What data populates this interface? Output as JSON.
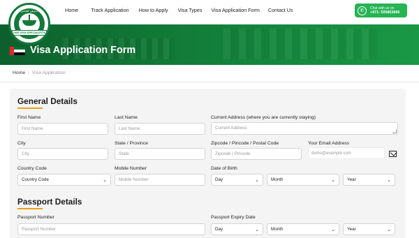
{
  "logo": {
    "top_text": "مكتب الدوبلي للتاشيرات",
    "ribbon": "UAE VISA SPECIALISTS"
  },
  "nav": [
    "Home",
    "Track Application",
    "How to Apply",
    "Visa Types",
    "Visa Application Form",
    "Contact Us"
  ],
  "whatsapp": {
    "line1": "Chat with us on",
    "line2": "+971- 505863666"
  },
  "banner": {
    "title": "Visa Application Form"
  },
  "colors": {
    "flag_red": "#e0262d",
    "flag_green": "#00732f",
    "flag_white": "#ffffff",
    "flag_black": "#000000"
  },
  "breadcrumb": {
    "home": "Home",
    "current": "Visa Application"
  },
  "general": {
    "title": "General Details",
    "first_name": {
      "label": "First Name",
      "placeholder": "First Name"
    },
    "last_name": {
      "label": "Last Name",
      "placeholder": "Last Name"
    },
    "address": {
      "label": "Current Address (where you are currently staying)",
      "placeholder": "Current Address"
    },
    "city": {
      "label": "City",
      "placeholder": "City"
    },
    "state": {
      "label": "State / Province",
      "placeholder": "State"
    },
    "zip": {
      "label": "Zipcode / Pincode / Postal Code",
      "placeholder": "Zipcode / Pincode"
    },
    "email": {
      "label": "Your Email Address",
      "placeholder": "demo@example.com"
    },
    "country_code": {
      "label": "Country Code",
      "value": "Country Code"
    },
    "mobile": {
      "label": "Mobile Number",
      "placeholder": "Mobile Number"
    },
    "dob": {
      "label": "Date of Birth",
      "day": "Day",
      "month": "Month",
      "year": "Year"
    }
  },
  "passport": {
    "title": "Passport Details",
    "number": {
      "label": "Passport Number",
      "placeholder": "Passport Number"
    },
    "expiry": {
      "label": "Passport Expiry Date",
      "day": "Day",
      "month": "Month",
      "year": "Year"
    }
  }
}
